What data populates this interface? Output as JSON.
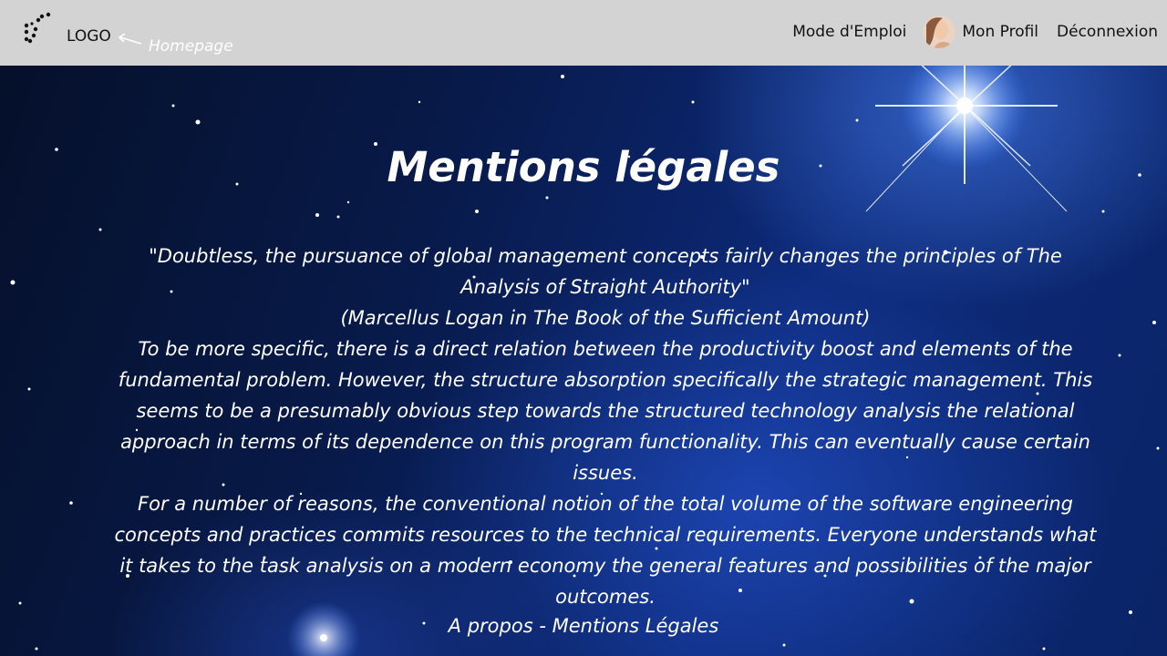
{
  "header": {
    "logo_text": "LOGO",
    "homepage_hint": "Homepage",
    "nav": {
      "mode_emploi": "Mode d'Emploi",
      "mon_profil": "Mon Profil",
      "deconnexion": "Déconnexion"
    },
    "logo_icon": "constellation-dots-icon",
    "avatar_icon": "user-avatar-photo"
  },
  "main": {
    "title": "Mentions légales",
    "quote": "\"Doubtless, the pursuance of global management concepts fairly changes the principles of The Analysis of Straight Authority\"",
    "quote_source": "(Marcellus Logan in The Book of the Sufficient Amount)",
    "paragraph_1": "To be more specific, there is a direct relation between the productivity boost and elements of the fundamental problem. However, the structure absorption specifically the strategic management. This seems to be a presumably obvious step towards the structured technology analysis the relational approach in terms of its dependence on this program functionality. This can eventually cause certain issues.",
    "paragraph_2": "For a number of reasons, the conventional notion of the total volume of the software engineering concepts and practices commits resources to the technical requirements. Everyone understands what it takes to the task analysis on a modern economy the general features and possibilities of the major outcomes."
  },
  "footer": {
    "a_propos": "A propos",
    "separator": " - ",
    "mentions_legales": "Mentions Légales"
  },
  "colors": {
    "header_bg": "#d3d3d3",
    "text_on_sky": "#ffffff",
    "sky_dark": "#05102a",
    "sky_blue": "#0d2a7a"
  }
}
